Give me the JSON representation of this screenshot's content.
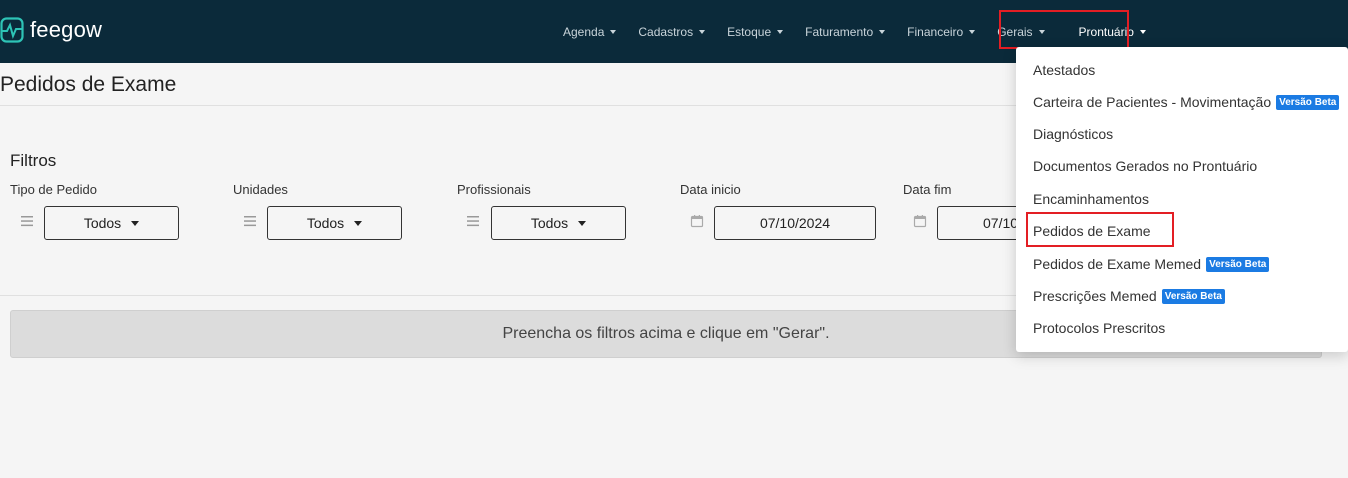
{
  "app": {
    "logo_text": "feegow"
  },
  "nav": {
    "items": [
      {
        "label": "Agenda"
      },
      {
        "label": "Cadastros"
      },
      {
        "label": "Estoque"
      },
      {
        "label": "Faturamento"
      },
      {
        "label": "Financeiro"
      },
      {
        "label": "Gerais"
      },
      {
        "label": "Prontuário"
      }
    ],
    "active": "Prontuário"
  },
  "page": {
    "title": "Pedidos de Exame"
  },
  "filters": {
    "title": "Filtros",
    "tipo_pedido": {
      "label": "Tipo de Pedido",
      "value": "Todos",
      "icon": "list-icon"
    },
    "unidades": {
      "label": "Unidades",
      "value": "Todos",
      "icon": "list-icon"
    },
    "profissionais": {
      "label": "Profissionais",
      "value": "Todos",
      "icon": "list-icon"
    },
    "data_inicio": {
      "label": "Data inicio",
      "value": "07/10/2024",
      "icon": "calendar-icon"
    },
    "data_fim": {
      "label": "Data fim",
      "value": "07/10",
      "icon": "calendar-icon"
    }
  },
  "message": "Preencha os filtros acima e clique em \"Gerar\".",
  "prontuario_menu": {
    "items": [
      {
        "label": "Atestados",
        "badge": ""
      },
      {
        "label": "Carteira de Pacientes - Movimentação",
        "badge": "Versão Beta"
      },
      {
        "label": "Diagnósticos",
        "badge": ""
      },
      {
        "label": "Documentos Gerados no Prontuário",
        "badge": ""
      },
      {
        "label": "Encaminhamentos",
        "badge": ""
      },
      {
        "label": "Pedidos de Exame",
        "badge": ""
      },
      {
        "label": "Pedidos de Exame Memed",
        "badge": "Versão Beta"
      },
      {
        "label": "Prescrições Memed",
        "badge": "Versão Beta"
      },
      {
        "label": "Protocolos Prescritos",
        "badge": ""
      }
    ]
  },
  "colors": {
    "navbar": "#0b2a3a",
    "accent_teal": "#2ec4b6",
    "badge_blue": "#1b7be3",
    "highlight_red": "#e31e24"
  }
}
